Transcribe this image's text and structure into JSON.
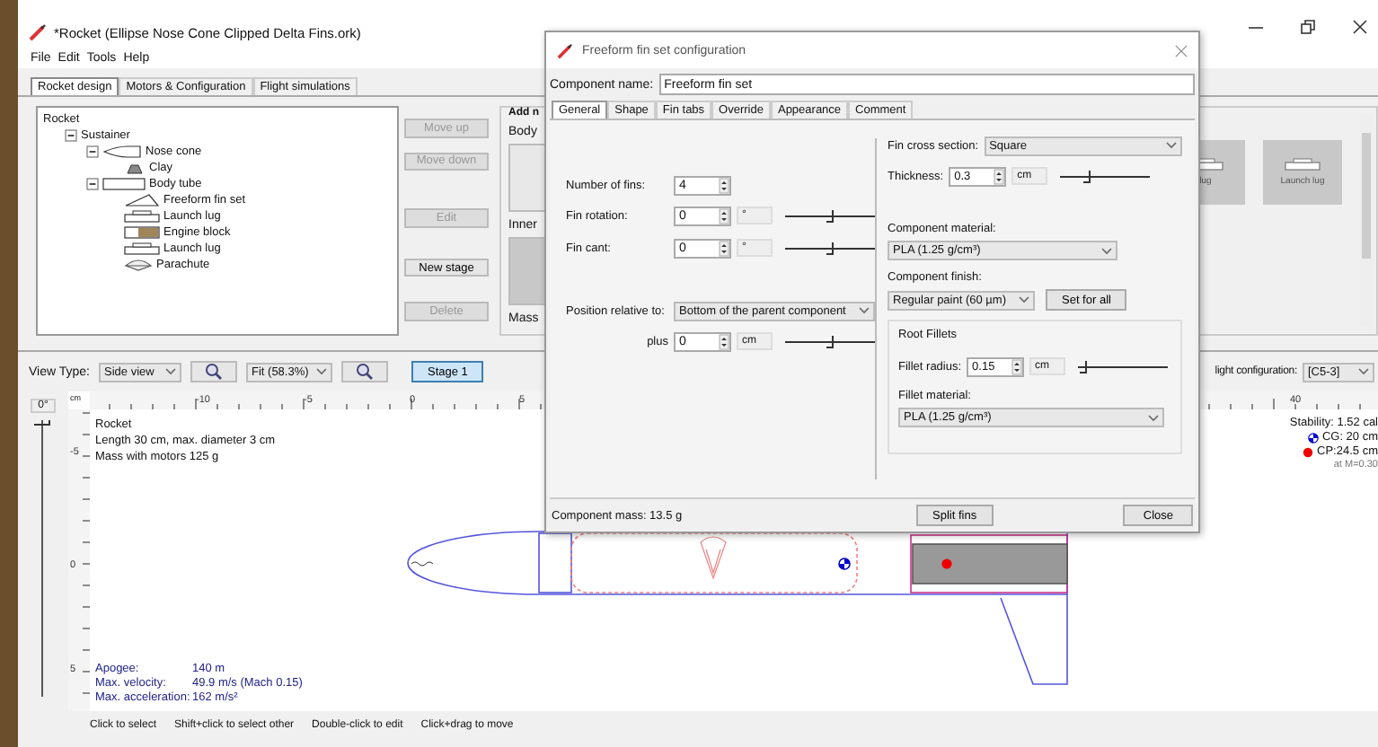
{
  "window": {
    "title": "*Rocket (Ellipse Nose Cone Clipped Delta Fins.ork)"
  },
  "menu": [
    "File",
    "Edit",
    "Tools",
    "Help"
  ],
  "tabs": [
    {
      "label": "Rocket design",
      "selected": true
    },
    {
      "label": "Motors & Configuration",
      "selected": false
    },
    {
      "label": "Flight simulations",
      "selected": false
    }
  ],
  "tree": {
    "label": "Rocket",
    "children": [
      {
        "label": "Sustainer",
        "expanded": true,
        "children": [
          {
            "label": "Nose cone",
            "kind": "nosecone",
            "expanded": true,
            "children": [
              {
                "label": "Clay",
                "kind": "mass"
              }
            ]
          },
          {
            "label": "Body tube",
            "kind": "bodytube",
            "expanded": true,
            "children": [
              {
                "label": "Freeform fin set",
                "kind": "fins"
              },
              {
                "label": "Launch lug",
                "kind": "lug"
              },
              {
                "label": "Engine block",
                "kind": "engine"
              },
              {
                "label": "Launch lug",
                "kind": "lug"
              },
              {
                "label": "Parachute",
                "kind": "parachute"
              }
            ]
          }
        ]
      }
    ]
  },
  "tree_buttons": [
    {
      "label": "Move up",
      "disabled": true
    },
    {
      "label": "Move down",
      "disabled": true
    },
    {
      "label": "Edit",
      "disabled": true
    },
    {
      "label": "New stage",
      "disabled": false
    },
    {
      "label": "Delete",
      "disabled": true
    }
  ],
  "add_panel": {
    "title": "Add n",
    "body_label": "Body",
    "inner_label": "Inner",
    "mass_label": "Mass",
    "components": [
      {
        "label": "lug"
      },
      {
        "label": "Launch lug"
      }
    ]
  },
  "view_toolbar": {
    "view_type_label": "View Type:",
    "view_type": "Side view",
    "zoom": "Fit (58.3%)",
    "stage": {
      "label": "Stage 1",
      "selected": true
    },
    "flight_config_label": "light configuration:",
    "flight_config": "[C5-3]"
  },
  "canvas": {
    "rotation": "0°",
    "ruler_unit": "cm",
    "x_ticks": [
      "-10",
      "-5",
      "0",
      "5",
      "40"
    ],
    "y_ticks": [
      "-5",
      "0",
      "5"
    ],
    "info": [
      "Rocket",
      "Length 30 cm, max. diameter 3 cm",
      "Mass with motors 125 g"
    ],
    "flight_stats": [
      {
        "label": "Apogee:",
        "value": "140 m"
      },
      {
        "label": "Max. velocity:",
        "value": "49.9 m/s  (Mach 0.15)"
      },
      {
        "label": "Max. acceleration:",
        "value": "162 m/s²"
      }
    ],
    "stability": "Stability: 1.52 cal",
    "cg": "CG:  20 cm",
    "cp": "CP:24.5 cm",
    "mach": "at M=0.30",
    "rotation_slider": {
      "level": 0
    }
  },
  "status_bar": [
    "Click to select",
    "Shift+click to select other",
    "Double-click to edit",
    "Click+drag to move"
  ],
  "dialog": {
    "title": "Freeform fin set configuration",
    "name_label": "Component name:",
    "name_value": "Freeform fin set",
    "tabs": [
      {
        "label": "General",
        "selected": true
      },
      {
        "label": "Shape",
        "selected": false
      },
      {
        "label": "Fin tabs",
        "selected": false
      },
      {
        "label": "Override",
        "selected": false
      },
      {
        "label": "Appearance",
        "selected": false
      },
      {
        "label": "Comment",
        "selected": false
      }
    ],
    "fins_label": "Number of fins:",
    "fins_value": "4",
    "rotation_label": "Fin rotation:",
    "rotation_value": "0",
    "rotation_unit": "°",
    "rotation_slider": {
      "level": 0.5
    },
    "cant_label": "Fin cant:",
    "cant_value": "0",
    "cant_unit": "°",
    "cant_slider": {
      "level": 0.5
    },
    "position_label": "Position relative to:",
    "position_value": "Bottom of the parent component",
    "plus_label": "plus",
    "plus_value": "0",
    "plus_unit": "cm",
    "plus_slider": {
      "level": 0.5
    },
    "cross_label": "Fin cross section:",
    "cross_value": "Square",
    "thickness_label": "Thickness:",
    "thickness_value": "0.3",
    "thickness_unit": "cm",
    "thickness_slider": {
      "level": 0.3
    },
    "material_label": "Component material:",
    "material_value": "PLA (1.25 g/cm³)",
    "finish_label": "Component finish:",
    "finish_value": "Regular paint (60 µm)",
    "set_all": "Set for all",
    "fillets_title": "Root Fillets",
    "fillet_radius_label": "Fillet radius:",
    "fillet_radius_value": "0.15",
    "fillet_radius_unit": "cm",
    "fillet_radius_slider": {
      "level": 0.05
    },
    "fillet_material_label": "Fillet material:",
    "fillet_material_value": "PLA (1.25 g/cm³)",
    "mass": "Component mass: 13.5 g",
    "split": "Split fins",
    "close": "Close"
  }
}
